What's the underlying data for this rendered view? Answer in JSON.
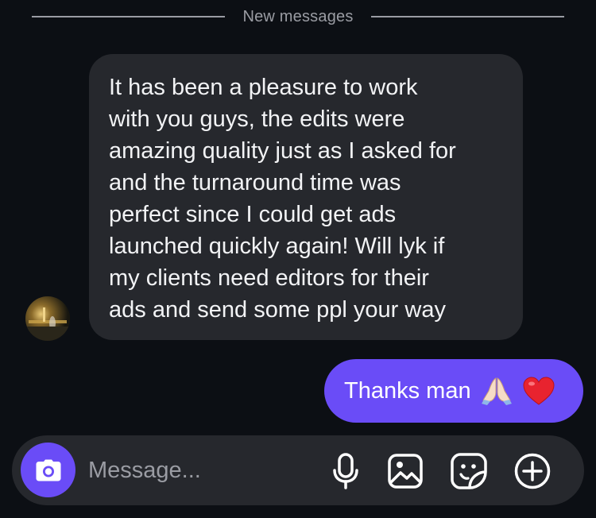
{
  "divider": {
    "label": "New messages"
  },
  "conversation": {
    "received": {
      "text": "It has been a pleasure to work\nwith you guys, the edits were\namazing quality just as I asked for\nand the turnaround time was\nperfect since I could get ads\nlaunched quickly again! Will lyk if\nmy clients need editors for their\nads and send some ppl your way"
    },
    "sent": {
      "text": "Thanks man",
      "emojis": [
        "folded-hands-emoji",
        "red-heart-emoji"
      ]
    }
  },
  "composer": {
    "placeholder": "Message...",
    "value": "",
    "icons": [
      "camera-icon",
      "microphone-icon",
      "image-icon",
      "sticker-icon",
      "plus-circle-icon"
    ]
  },
  "colors": {
    "background": "#0c0f14",
    "received_bubble": "#26282d",
    "sent_bubble": "#6a4cf7",
    "accent": "#6a4cf7",
    "muted_text": "#9a9ca3"
  }
}
